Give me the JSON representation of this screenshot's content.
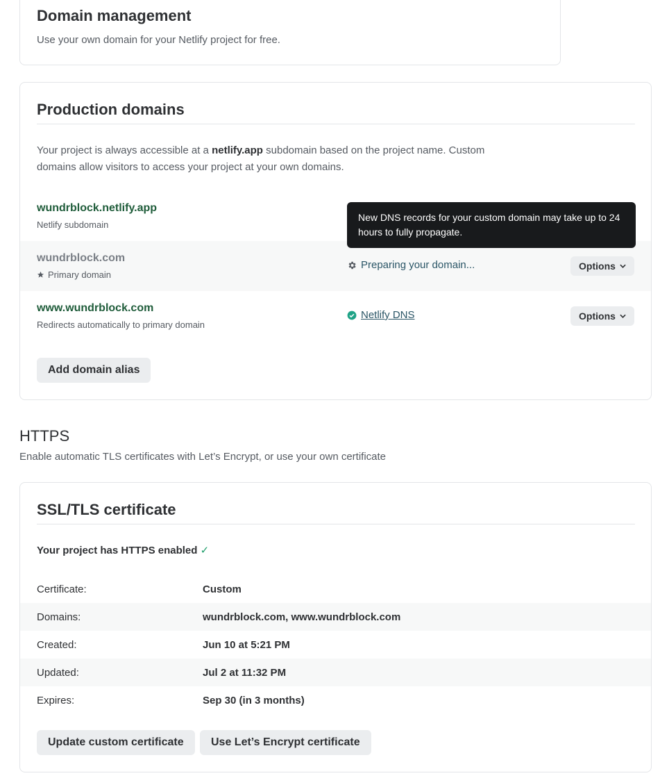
{
  "domain_management": {
    "title": "Domain management",
    "description": "Use your own domain for your Netlify project for free."
  },
  "production_domains": {
    "title": "Production domains",
    "description_pre": "Your project is always accessible at a ",
    "description_bold": "netlify.app",
    "description_post": " subdomain based on the project name. Custom domains allow visitors to access your project at your own domains.",
    "domains": [
      {
        "name": "wundrblock.netlify.app",
        "subtitle": "Netlify subdomain"
      },
      {
        "name": "wundrblock.com",
        "subtitle": "Primary domain",
        "status": "Preparing your domain...",
        "options_label": "Options"
      },
      {
        "name": "www.wundrblock.com",
        "subtitle": "Redirects automatically to primary domain",
        "status": "Netlify DNS",
        "options_label": "Options"
      }
    ],
    "tooltip": "New DNS records for your custom domain may take up to 24 hours to fully propagate.",
    "add_alias_label": "Add domain alias"
  },
  "https": {
    "title": "HTTPS",
    "description": "Enable automatic TLS certificates with Let’s Encrypt, or use your own certificate"
  },
  "ssl": {
    "title": "SSL/TLS certificate",
    "enabled_text": "Your project has HTTPS enabled",
    "check_glyph": "✓",
    "rows": [
      {
        "key": "Certificate:",
        "value": "Custom"
      },
      {
        "key": "Domains:",
        "value": "wundrblock.com, www.wundrblock.com"
      },
      {
        "key": "Created:",
        "value": "Jun 10 at 5:21 PM"
      },
      {
        "key": "Updated:",
        "value": "Jul 2 at 11:32 PM"
      },
      {
        "key": "Expires:",
        "value": "Sep 30 (in 3 months)"
      }
    ],
    "update_button": "Update custom certificate",
    "letsencrypt_button": "Use Let’s Encrypt certificate"
  },
  "icons": {
    "star": "star-icon",
    "gear": "gear-icon",
    "check_circle": "check-circle-icon",
    "chevron": "chevron-down-icon"
  },
  "colors": {
    "domain_link": "#1f5c3a",
    "status_text": "#2a5566",
    "check_green": "#1e9e6a",
    "tooltip_bg": "#181a1c"
  }
}
